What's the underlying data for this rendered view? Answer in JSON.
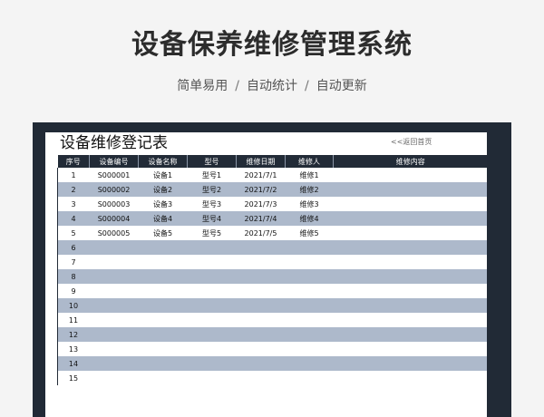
{
  "hero": {
    "title": "设备保养维修管理系统",
    "features": [
      "简单易用",
      "自动统计",
      "自动更新"
    ],
    "separator": "/"
  },
  "sheet": {
    "title": "设备维修登记表",
    "back_link": "<<返回首页",
    "columns": [
      "序号",
      "设备编号",
      "设备名称",
      "型号",
      "维修日期",
      "维修人",
      "维修内容"
    ],
    "rows": [
      [
        "1",
        "S000001",
        "设备1",
        "型号1",
        "2021/7/1",
        "维修1",
        ""
      ],
      [
        "2",
        "S000002",
        "设备2",
        "型号2",
        "2021/7/2",
        "维修2",
        ""
      ],
      [
        "3",
        "S000003",
        "设备3",
        "型号3",
        "2021/7/3",
        "维修3",
        ""
      ],
      [
        "4",
        "S000004",
        "设备4",
        "型号4",
        "2021/7/4",
        "维修4",
        ""
      ],
      [
        "5",
        "S000005",
        "设备5",
        "型号5",
        "2021/7/5",
        "维修5",
        ""
      ],
      [
        "6",
        "",
        "",
        "",
        "",
        "",
        ""
      ],
      [
        "7",
        "",
        "",
        "",
        "",
        "",
        ""
      ],
      [
        "8",
        "",
        "",
        "",
        "",
        "",
        ""
      ],
      [
        "9",
        "",
        "",
        "",
        "",
        "",
        ""
      ],
      [
        "10",
        "",
        "",
        "",
        "",
        "",
        ""
      ],
      [
        "11",
        "",
        "",
        "",
        "",
        "",
        ""
      ],
      [
        "12",
        "",
        "",
        "",
        "",
        "",
        ""
      ],
      [
        "13",
        "",
        "",
        "",
        "",
        "",
        ""
      ],
      [
        "14",
        "",
        "",
        "",
        "",
        "",
        ""
      ],
      [
        "15",
        "",
        "",
        "",
        "",
        "",
        ""
      ]
    ]
  },
  "colors": {
    "header_bg": "#222b37",
    "stripe": "#adb9cb",
    "frame": "#212a36"
  }
}
